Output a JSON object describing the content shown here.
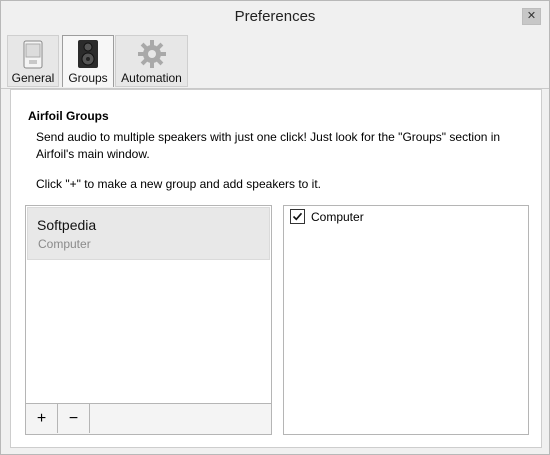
{
  "window": {
    "title": "Preferences",
    "close_glyph": "✕"
  },
  "tabs": [
    {
      "label": "General",
      "icon": "device-icon"
    },
    {
      "label": "Groups",
      "icon": "speakers-icon",
      "active": true
    },
    {
      "label": "Automation",
      "icon": "gear-icon"
    }
  ],
  "groups_page": {
    "title": "Airfoil Groups",
    "description": "Send audio to multiple speakers with just one click! Just look for the \"Groups\" section in Airfoil's main window.",
    "hint": "Click \"+\" to make a new group and add speakers to it.",
    "groups": [
      {
        "name": "Softpedia",
        "subtitle": "Computer"
      }
    ],
    "add_label": "+",
    "remove_label": "−",
    "speakers": [
      {
        "label": "Computer",
        "checked": true
      }
    ]
  },
  "colors": {
    "window_bg": "#f0f0f0",
    "selected_item_bg": "#e8e8e8",
    "close_button_bg": "#c7c7c7"
  }
}
